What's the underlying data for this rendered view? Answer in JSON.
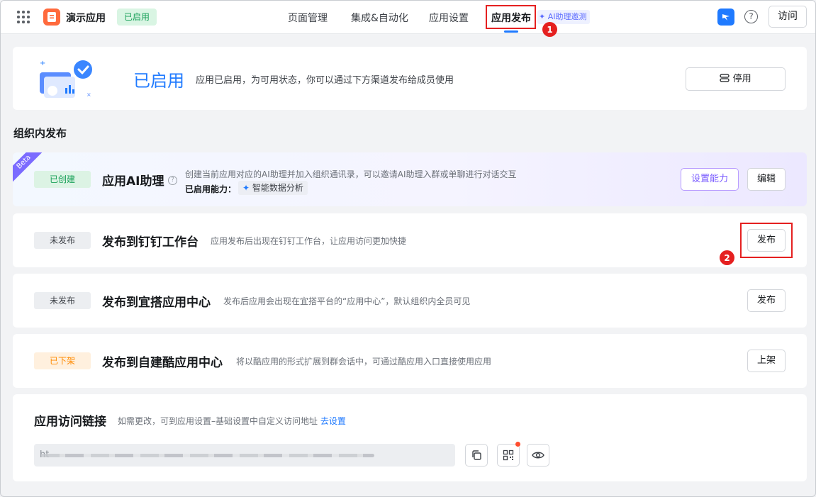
{
  "header": {
    "app_name": "演示应用",
    "app_status": "已启用",
    "nav": [
      "页面管理",
      "集成&自动化",
      "应用设置",
      "应用发布"
    ],
    "ai_tag": "AI助理邀测",
    "visit_label": "访问",
    "help_glyph": "?"
  },
  "annotations": {
    "marker_1": "1",
    "marker_2": "2"
  },
  "enabled_panel": {
    "title": "已启用",
    "description": "应用已启用，为可用状态，你可以通过下方渠道发布给成员使用",
    "disable_label": "停用"
  },
  "section_title": "组织内发布",
  "channels": [
    {
      "ribbon": "Beta",
      "status": "已创建",
      "title": "应用AI助理",
      "description": "创建当前应用对应的AI助理并加入组织通讯录，可以邀请AI助理入群或单聊进行对话交互",
      "capability_label": "已启用能力：",
      "capability_value": "智能数据分析",
      "secondary_action": "设置能力",
      "primary_action": "编辑"
    },
    {
      "status": "未发布",
      "title": "发布到钉钉工作台",
      "description": "应用发布后出现在钉钉工作台，让应用访问更加快捷",
      "primary_action": "发布"
    },
    {
      "status": "未发布",
      "title": "发布到宜搭应用中心",
      "description": "发布后应用会出现在宜搭平台的“应用中心”，默认组织内全员可见",
      "primary_action": "发布"
    },
    {
      "status": "已下架",
      "title": "发布到自建酷应用中心",
      "description": "将以酷应用的形式扩展到群会话中，可通过酷应用入口直接使用应用",
      "primary_action": "上架"
    }
  ],
  "access_link": {
    "title": "应用访问链接",
    "description": "如需更改，可到应用设置–基础设置中自定义访问地址",
    "link_text": "去设置",
    "url_prefix": "ht",
    "actions": [
      "copy-icon",
      "qrcode-icon",
      "eye-icon"
    ]
  },
  "colors": {
    "accent": "#1f7aff",
    "enabled_green": "#18a058",
    "removed_orange": "#ff8a00",
    "highlight_red": "#e52020",
    "ai_purple": "#7a5cff"
  }
}
